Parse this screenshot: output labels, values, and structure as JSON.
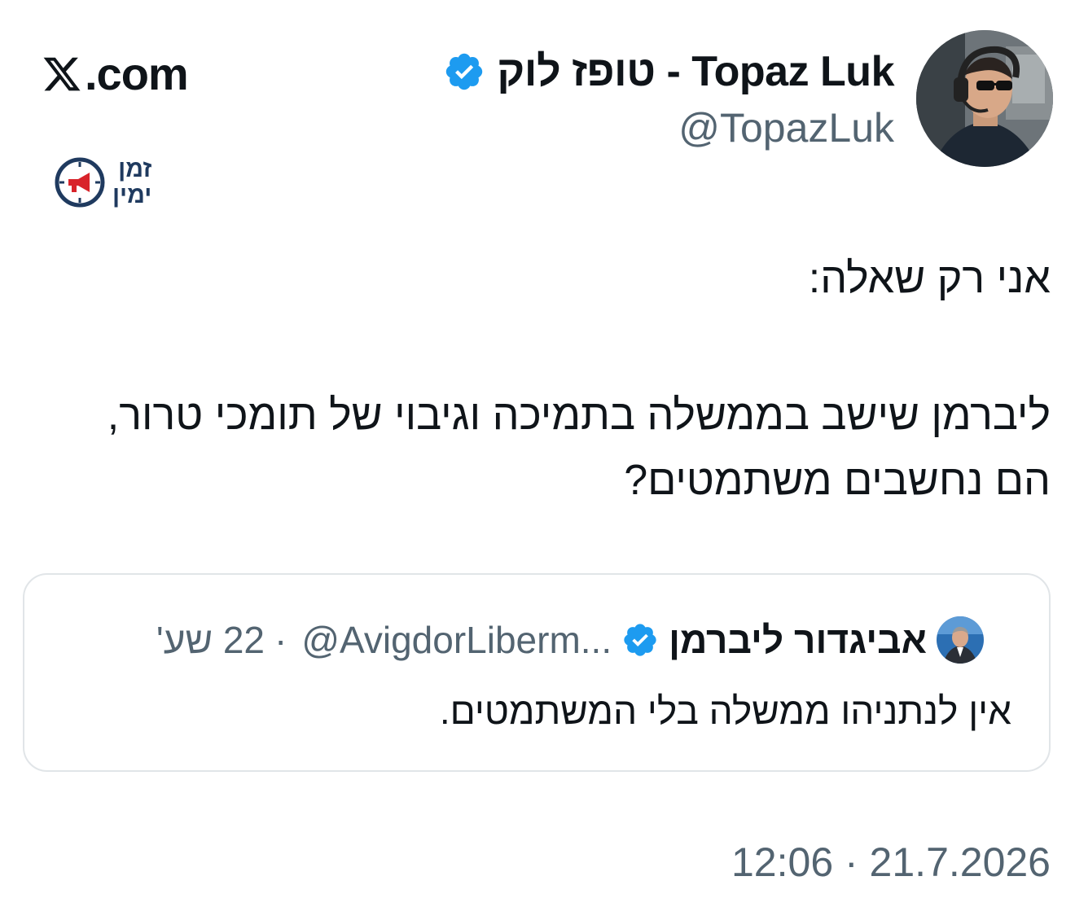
{
  "author": {
    "display_name": "טופז לוק - Topaz Luk",
    "handle": "@TopazLuk",
    "verified": true
  },
  "site_label": ".com",
  "channel_logo": {
    "line1": "זמן",
    "line2": "ימין"
  },
  "tweet": {
    "line1": "אני רק שאלה:",
    "line2": "ליברמן שישב בממשלה בתמיכה וגיבוי של תומכי טרור, הם נחשבים משתמטים?"
  },
  "quoted_tweet": {
    "display_name": "אביגדור ליברמן",
    "handle": "@AvigdorLiberm...",
    "separator": "·",
    "time_ago": "22 שע'",
    "text": "אין לנתניהו ממשלה בלי המשתמטים."
  },
  "timestamp": "12:06 · 21.7.2026",
  "colors": {
    "verified_blue": "#1d9bf0",
    "secondary_text": "#536471",
    "card_border": "#e1e5e8",
    "channel_navy": "#1f3a5f",
    "channel_red": "#d8232a"
  }
}
